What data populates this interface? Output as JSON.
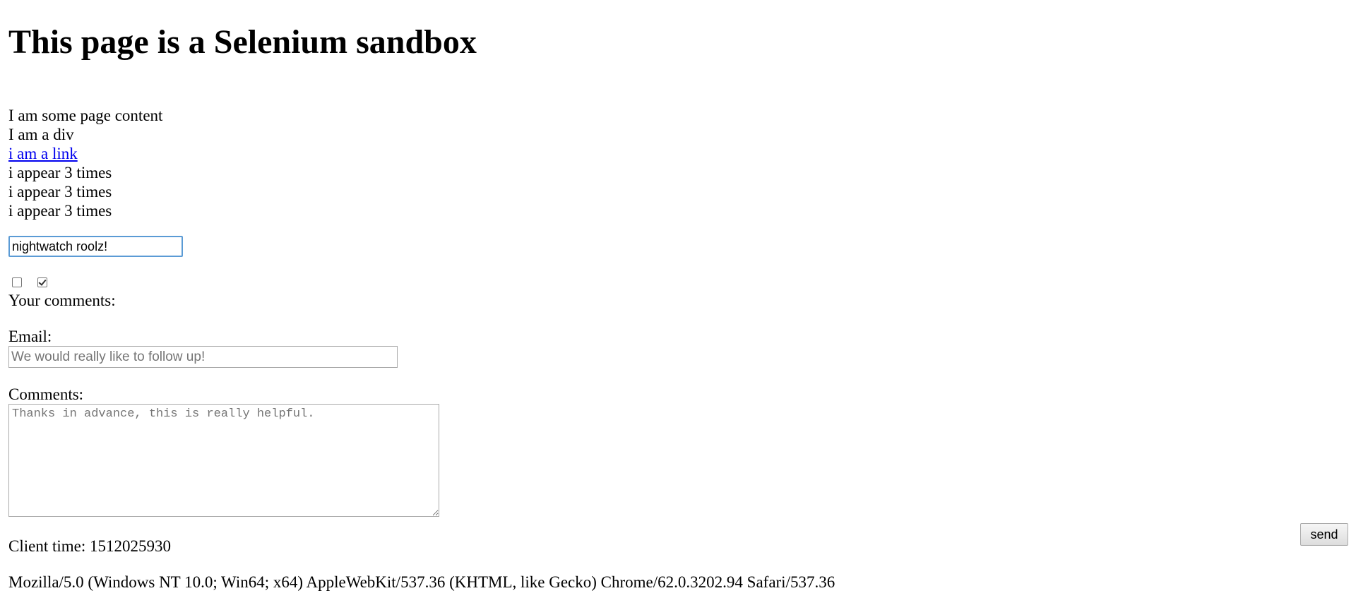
{
  "page": {
    "heading": "This page is a Selenium sandbox"
  },
  "content": {
    "text_1": "I am some page content",
    "div_text": "I am a div",
    "link_text": "i am a link",
    "repeated": [
      "i appear 3 times",
      "i appear 3 times",
      "i appear 3 times"
    ]
  },
  "name_input": {
    "value": "nightwatch roolz!"
  },
  "checkboxes": [
    {
      "checked": false
    },
    {
      "checked": true
    }
  ],
  "form": {
    "title": "Your comments:",
    "email_label": "Email:",
    "email_placeholder": "We would really like to follow up!",
    "comments_label": "Comments:",
    "comments_placeholder": "Thanks in advance, this is really helpful.",
    "send_label": "send"
  },
  "footer": {
    "client_time": "Client time: 1512025930",
    "user_agent": "Mozilla/5.0 (Windows NT 10.0; Win64; x64) AppleWebKit/537.36 (KHTML, like Gecko) Chrome/62.0.3202.94 Safari/537.36"
  },
  "colors": {
    "link": "#0000ee",
    "focus_border": "#5b9bd5"
  }
}
